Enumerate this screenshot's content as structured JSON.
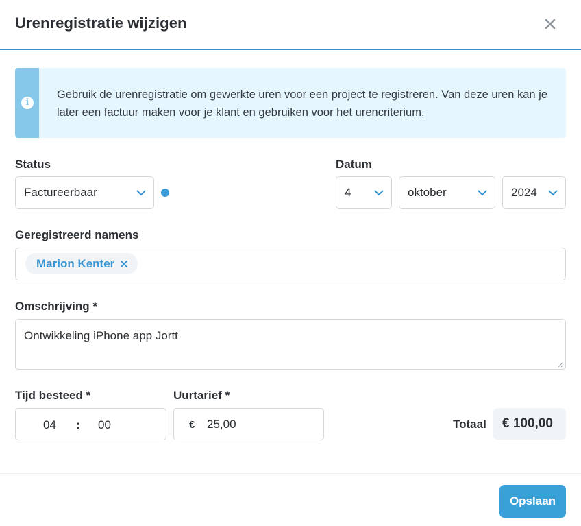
{
  "dialog": {
    "title": "Urenregistratie wijzigen",
    "close_icon": "close-icon"
  },
  "info": {
    "icon": "info-icon",
    "glyph": "i",
    "text": "Gebruik de urenregistratie om gewerkte uren voor een project te registreren. Van deze uren kan je later een factuur maken voor je klant en gebruiken voor het urencriterium."
  },
  "status": {
    "label": "Status",
    "value": "Factureerbaar",
    "dot_color": "#3a9bd6"
  },
  "date": {
    "label": "Datum",
    "day": "4",
    "month": "oktober",
    "year": "2024"
  },
  "registered_for": {
    "label": "Geregistreerd namens",
    "tags": [
      "Marion Kenter"
    ]
  },
  "description": {
    "label": "Omschrijving *",
    "value": "Ontwikkeling iPhone app Jortt"
  },
  "time": {
    "label": "Tijd besteed *",
    "hours": "04",
    "separator": ":",
    "minutes": "00"
  },
  "rate": {
    "label": "Uurtarief *",
    "currency": "€",
    "value": "25,00"
  },
  "total": {
    "label": "Totaal",
    "value": "€ 100,00"
  },
  "actions": {
    "save_label": "Opslaan"
  },
  "colors": {
    "accent": "#3aa0d8",
    "info_background": "#e6f6fe",
    "info_stripe": "#86c8ea",
    "header_border": "#3a8fc2"
  }
}
